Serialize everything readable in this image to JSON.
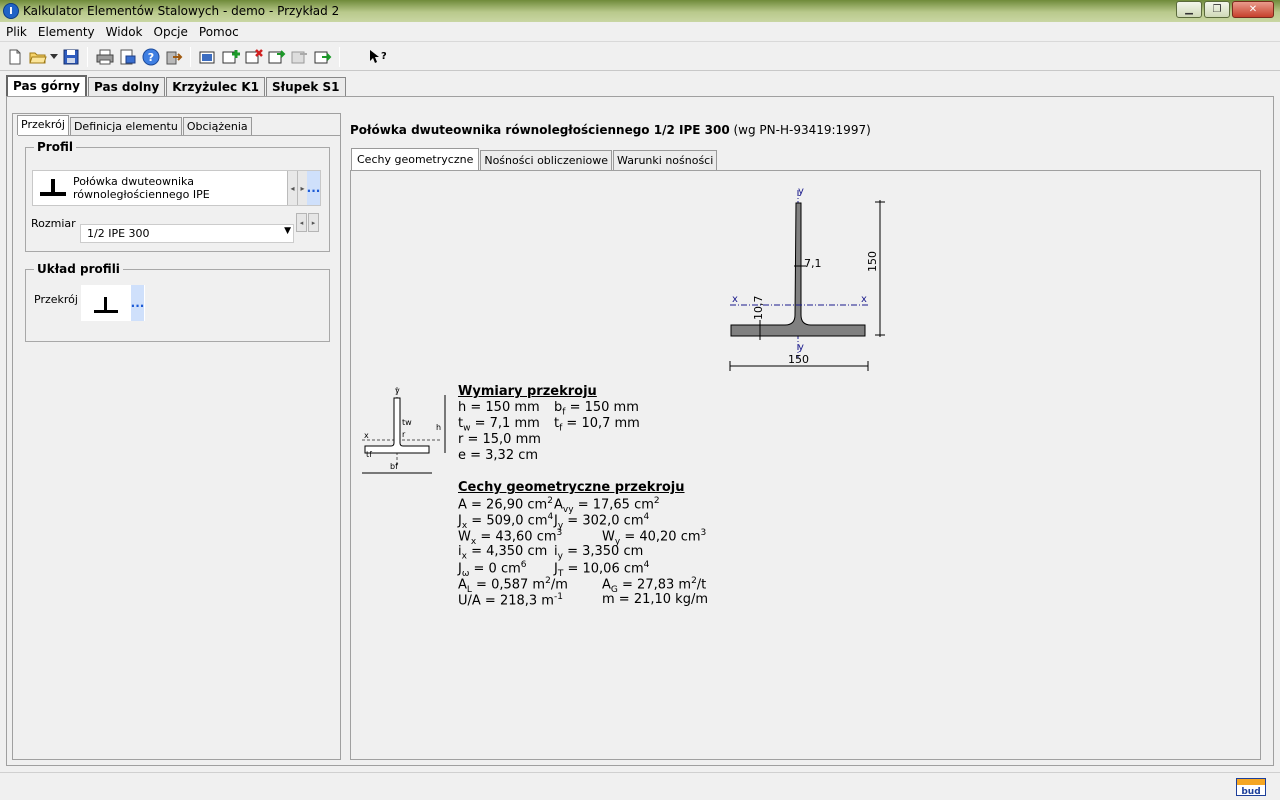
{
  "window": {
    "title": "Kalkulator Elementów Stalowych - demo - Przykład 2"
  },
  "menu": [
    "Plik",
    "Elementy",
    "Widok",
    "Opcje",
    "Pomoc"
  ],
  "toolbar": {
    "buttons": [
      "new-file-icon",
      "open-folder-icon",
      "dropdown-arrow-icon",
      "save-icon",
      "print-icon",
      "print-preview-icon",
      "help-icon",
      "export-icon",
      "element-icon",
      "add-element-icon",
      "delete-element-icon",
      "copy-element-icon",
      "element-disabled-icon",
      "export-element-icon",
      "context-help-icon"
    ]
  },
  "element_tabs": [
    "Pas górny",
    "Pas dolny",
    "Krzyżulec K1",
    "Słupek S1"
  ],
  "left": {
    "tabs": [
      "Przekrój",
      "Definicja elementu",
      "Obciążenia"
    ],
    "profil": {
      "title": "Profil",
      "name_line1": "Połówka dwuteownika",
      "name_line2": "równoległościennego IPE",
      "dots": "...",
      "size_label": "Rozmiar",
      "size_value": "1/2 IPE 300"
    },
    "uklad": {
      "title": "Układ profili",
      "label": "Przekrój",
      "dots": "..."
    }
  },
  "right": {
    "heading_bold": "Połówka dwuteownika równoległościennego 1/2 IPE 300",
    "heading_norm": " (wg PN-H-93419:1997)",
    "tabs": [
      "Cechy geometryczne",
      "Nośności obliczeniowe",
      "Warunki nośności"
    ],
    "drawing": {
      "x": "x",
      "y": "y",
      "tw_val": "7,1",
      "tf_val": "10,7",
      "h_val": "150",
      "bf_val": "150"
    },
    "small_drawing": {
      "tw": "tw",
      "h": "h",
      "bf": "bf",
      "tf": "tf",
      "r": "r",
      "x": "x",
      "y": "y"
    },
    "dims": {
      "title": "Wymiary przekroju",
      "h": "h = 150 mm",
      "bf": "b",
      "bf_sub": "f",
      "bf_val": " = 150 mm",
      "tw": "t",
      "tw_sub": "w",
      "tw_val": " = 7,1 mm",
      "tf": "t",
      "tf_sub": "f",
      "tf_val": " = 10,7 mm",
      "r": "r = 15,0 mm",
      "e": "e = 3,32 cm"
    },
    "props": {
      "title": "Cechy geometryczne przekroju",
      "A": "A = 26,90 cm",
      "A_sup": "2",
      "Avy": "A",
      "Avy_sub": "vy",
      "Avy_val": " = 17,65 cm",
      "Avy_sup": "2",
      "Jx": "J",
      "Jx_sub": "x",
      "Jx_val": " = 509,0 cm",
      "Jx_sup": "4",
      "Jy": "J",
      "Jy_sub": "y",
      "Jy_val": " = 302,0 cm",
      "Jy_sup": "4",
      "Wx": "W",
      "Wx_sub": "x",
      "Wx_val": " = 43,60 cm",
      "Wx_sup": "3",
      "Wy": "W",
      "Wy_sub": "y",
      "Wy_val": " = 40,20 cm",
      "Wy_sup": "3",
      "ix": "i",
      "ix_sub": "x",
      "ix_val": " = 4,350 cm",
      "iy": "i",
      "iy_sub": "y",
      "iy_val": " = 3,350 cm",
      "Jo": "J",
      "Jo_sub": "ω",
      "Jo_val": " = 0 cm",
      "Jo_sup": "6",
      "JT": "J",
      "JT_sub": "T",
      "JT_val": " = 10,06 cm",
      "JT_sup": "4",
      "AL": "A",
      "AL_sub": "L",
      "AL_val": " = 0,587 m",
      "AL_sup": "2",
      "AL_unit": "/m",
      "AG": "A",
      "AG_sub": "G",
      "AG_val": " = 27,83 m",
      "AG_sup": "2",
      "AG_unit": "/t",
      "UA": "U/A = 218,3 m",
      "UA_sup": "-1",
      "m": "m = 21,10 kg/m"
    }
  },
  "status": {
    "logo": "bud"
  }
}
